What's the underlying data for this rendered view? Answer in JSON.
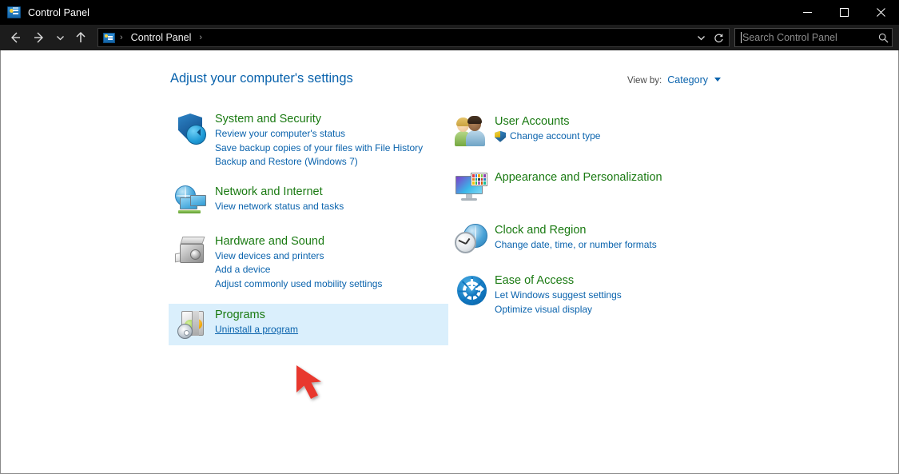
{
  "window": {
    "title": "Control Panel",
    "title_icon": "control-panel-icon",
    "minimize_label": "Minimize",
    "maximize_label": "Maximize",
    "close_label": "Close"
  },
  "navbar": {
    "back_icon": "arrow-left-icon",
    "forward_icon": "arrow-right-icon",
    "recent_icon": "chevron-down-icon",
    "up_icon": "arrow-up-icon",
    "breadcrumb": {
      "icon": "control-panel-icon",
      "separator": "›",
      "items": [
        "Control Panel"
      ],
      "trailing_separator": "›"
    },
    "history_dropdown_icon": "chevron-down-icon",
    "refresh_icon": "refresh-icon"
  },
  "search": {
    "placeholder": "Search Control Panel",
    "value": "",
    "icon": "search-icon"
  },
  "main": {
    "page_title": "Adjust your computer's settings",
    "view_by": {
      "label": "View by:",
      "value": "Category",
      "caret_icon": "caret-down-icon"
    }
  },
  "categories": {
    "left": [
      {
        "id": "system-and-security",
        "icon": "shield-icon",
        "title": "System and Security",
        "highlighted": false,
        "links": [
          {
            "text": "Review your computer's status",
            "hovered": false,
            "shield": false
          },
          {
            "text": "Save backup copies of your files with File History",
            "hovered": false,
            "shield": false
          },
          {
            "text": "Backup and Restore (Windows 7)",
            "hovered": false,
            "shield": false
          }
        ]
      },
      {
        "id": "network-and-internet",
        "icon": "network-globe-monitor-icon",
        "title": "Network and Internet",
        "highlighted": false,
        "links": [
          {
            "text": "View network status and tasks",
            "hovered": false,
            "shield": false
          }
        ]
      },
      {
        "id": "hardware-and-sound",
        "icon": "printer-icon",
        "title": "Hardware and Sound",
        "highlighted": false,
        "links": [
          {
            "text": "View devices and printers",
            "hovered": false,
            "shield": false
          },
          {
            "text": "Add a device",
            "hovered": false,
            "shield": false
          },
          {
            "text": "Adjust commonly used mobility settings",
            "hovered": false,
            "shield": false
          }
        ]
      },
      {
        "id": "programs",
        "icon": "programs-box-cd-icon",
        "title": "Programs",
        "highlighted": true,
        "links": [
          {
            "text": "Uninstall a program",
            "hovered": true,
            "shield": false
          }
        ]
      }
    ],
    "right": [
      {
        "id": "user-accounts",
        "icon": "users-icon",
        "title": "User Accounts",
        "highlighted": false,
        "links": [
          {
            "text": "Change account type",
            "hovered": false,
            "shield": true
          }
        ]
      },
      {
        "id": "appearance-and-personalization",
        "icon": "monitor-palette-icon",
        "title": "Appearance and Personalization",
        "highlighted": false,
        "links": []
      },
      {
        "id": "clock-and-region",
        "icon": "clock-globe-icon",
        "title": "Clock and Region",
        "highlighted": false,
        "links": [
          {
            "text": "Change date, time, or number formats",
            "hovered": false,
            "shield": false
          }
        ]
      },
      {
        "id": "ease-of-access",
        "icon": "ease-of-access-icon",
        "title": "Ease of Access",
        "highlighted": false,
        "links": [
          {
            "text": "Let Windows suggest settings",
            "hovered": false,
            "shield": false
          },
          {
            "text": "Optimize visual display",
            "hovered": false,
            "shield": false
          }
        ]
      }
    ]
  },
  "annotation": {
    "type": "red-arrow",
    "points_at": "Uninstall a program",
    "color": "#e8382e"
  },
  "colors": {
    "titlebar_bg": "#000000",
    "navbar_bg": "#1c1c1c",
    "content_bg": "#ffffff",
    "category_title": "#1a7a12",
    "link": "#0a63ad",
    "page_title": "#0a63ad",
    "highlight_row": "#daeffc",
    "annotation_red": "#e8382e"
  }
}
